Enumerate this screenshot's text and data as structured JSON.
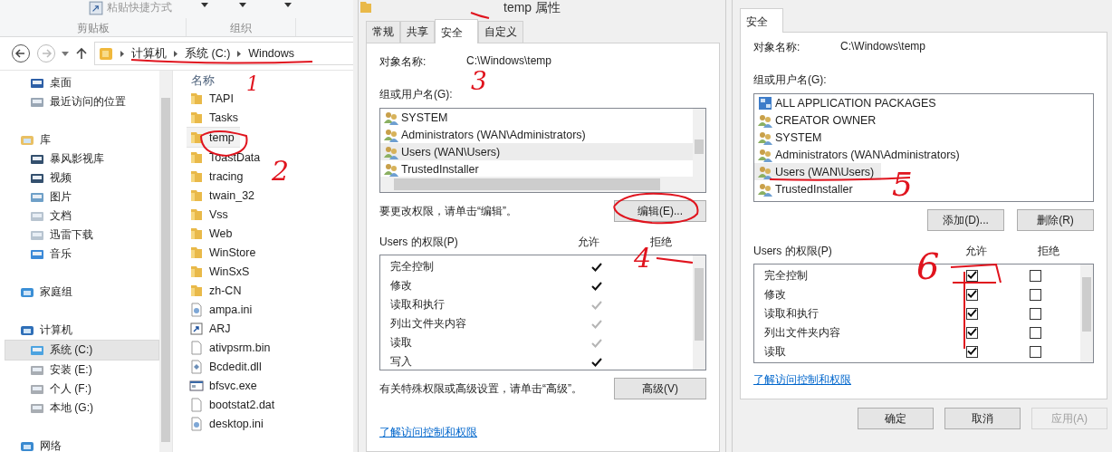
{
  "explorer": {
    "ribbon": {
      "command": "粘贴快捷方式",
      "groups": [
        "剪贴板",
        "组织"
      ]
    },
    "address": [
      "计算机",
      "系统 (C:)",
      "Windows"
    ],
    "nav": [
      {
        "children": [
          {
            "label": "桌面",
            "selected": false
          },
          {
            "label": "最近访问的位置",
            "selected": false
          }
        ]
      },
      {
        "label": "库",
        "children": [
          {
            "label": "暴风影视库",
            "selected": false
          },
          {
            "label": "视频",
            "selected": false
          },
          {
            "label": "图片",
            "selected": false
          },
          {
            "label": "文档",
            "selected": false
          },
          {
            "label": "迅雷下载",
            "selected": false
          },
          {
            "label": "音乐",
            "selected": false
          }
        ]
      },
      {
        "label": "家庭组"
      },
      {
        "label": "计算机",
        "children": [
          {
            "label": "系统 (C:)",
            "selected": true
          },
          {
            "label": "安装 (E:)",
            "selected": false
          },
          {
            "label": "个人 (F:)",
            "selected": false
          },
          {
            "label": "本地 (G:)",
            "selected": false
          }
        ]
      },
      {
        "label": "网络"
      }
    ],
    "column": "名称",
    "files": [
      {
        "name": "TAPI",
        "kind": "folder",
        "selected": false
      },
      {
        "name": "Tasks",
        "kind": "folder",
        "selected": false
      },
      {
        "name": "temp",
        "kind": "folder",
        "selected": true
      },
      {
        "name": "ToastData",
        "kind": "folder",
        "selected": false
      },
      {
        "name": "tracing",
        "kind": "folder",
        "selected": false
      },
      {
        "name": "twain_32",
        "kind": "folder",
        "selected": false
      },
      {
        "name": "Vss",
        "kind": "folder",
        "selected": false
      },
      {
        "name": "Web",
        "kind": "folder",
        "selected": false
      },
      {
        "name": "WinStore",
        "kind": "folder",
        "selected": false
      },
      {
        "name": "WinSxS",
        "kind": "folder",
        "selected": false
      },
      {
        "name": "zh-CN",
        "kind": "folder",
        "selected": false
      },
      {
        "name": "ampa.ini",
        "kind": "settings",
        "selected": false
      },
      {
        "name": "ARJ",
        "kind": "shortcut",
        "selected": false
      },
      {
        "name": "ativpsrm.bin",
        "kind": "file",
        "selected": false
      },
      {
        "name": "Bcdedit.dll",
        "kind": "dll",
        "selected": false
      },
      {
        "name": "bfsvc.exe",
        "kind": "exe",
        "selected": false
      },
      {
        "name": "bootstat2.dat",
        "kind": "file",
        "selected": false
      },
      {
        "name": "desktop.ini",
        "kind": "settings",
        "selected": false
      }
    ]
  },
  "properties": {
    "title": "temp 属性",
    "tabs": [
      {
        "label": "常规",
        "selected": false
      },
      {
        "label": "共享",
        "selected": false
      },
      {
        "label": "安全",
        "selected": true
      },
      {
        "label": "自定义",
        "selected": false
      }
    ],
    "object_label": "对象名称:",
    "object_name": "C:\\Windows\\temp",
    "group_label": "组或用户名(G):",
    "principals": [
      {
        "name": "SYSTEM",
        "kind": "group",
        "selected": false
      },
      {
        "name": "Administrators (WAN\\Administrators)",
        "kind": "group",
        "selected": false
      },
      {
        "name": "Users (WAN\\Users)",
        "kind": "group",
        "selected": true
      },
      {
        "name": "TrustedInstaller",
        "kind": "group",
        "selected": false
      }
    ],
    "edit_hint": "要更改权限，请单击“编辑”。",
    "edit_button": "编辑(E)...",
    "perm_label": "Users 的权限(P)",
    "allow_header": "允许",
    "deny_header": "拒绝",
    "permissions": [
      {
        "name": "完全控制",
        "allow": true,
        "inherited": false
      },
      {
        "name": "修改",
        "allow": true,
        "inherited": false
      },
      {
        "name": "读取和执行",
        "allow": true,
        "inherited": true
      },
      {
        "name": "列出文件夹内容",
        "allow": true,
        "inherited": true
      },
      {
        "name": "读取",
        "allow": true,
        "inherited": true
      },
      {
        "name": "写入",
        "allow": true,
        "inherited": false
      }
    ],
    "advanced_hint": "有关特殊权限或高级设置，请单击“高级”。",
    "advanced_button": "高级(V)",
    "link": "了解访问控制和权限"
  },
  "editor": {
    "tabs": [
      {
        "label": "安全",
        "selected": true
      }
    ],
    "object_label": "对象名称:",
    "object_name": "C:\\Windows\\temp",
    "group_label": "组或用户名(G):",
    "principals": [
      {
        "name": "ALL APPLICATION PACKAGES",
        "kind": "package",
        "selected": false
      },
      {
        "name": "CREATOR OWNER",
        "kind": "group",
        "selected": false
      },
      {
        "name": "SYSTEM",
        "kind": "group",
        "selected": false
      },
      {
        "name": "Administrators (WAN\\Administrators)",
        "kind": "group",
        "selected": false
      },
      {
        "name": "Users (WAN\\Users)",
        "kind": "group",
        "selected": true
      },
      {
        "name": "TrustedInstaller",
        "kind": "group",
        "selected": false
      }
    ],
    "buttons": [
      {
        "label": "添加(D)...",
        "disabled": false
      },
      {
        "label": "删除(R)",
        "disabled": false
      }
    ],
    "perm_label": "Users 的权限(P)",
    "allow_header": "允许",
    "deny_header": "拒绝",
    "permissions": [
      {
        "name": "完全控制",
        "allow": true,
        "deny": false
      },
      {
        "name": "修改",
        "allow": true,
        "deny": false
      },
      {
        "name": "读取和执行",
        "allow": true,
        "deny": false
      },
      {
        "name": "列出文件夹内容",
        "allow": true,
        "deny": false
      },
      {
        "name": "读取",
        "allow": true,
        "deny": false
      }
    ],
    "link": "了解访问控制和权限",
    "footer": [
      {
        "label": "确定",
        "disabled": false
      },
      {
        "label": "取消",
        "disabled": false
      },
      {
        "label": "应用(A)",
        "disabled": true
      }
    ]
  },
  "annotations": [
    {
      "label": "1"
    },
    {
      "label": "2"
    },
    {
      "label": "3"
    },
    {
      "label": "4"
    },
    {
      "label": "5"
    },
    {
      "label": "6"
    }
  ]
}
